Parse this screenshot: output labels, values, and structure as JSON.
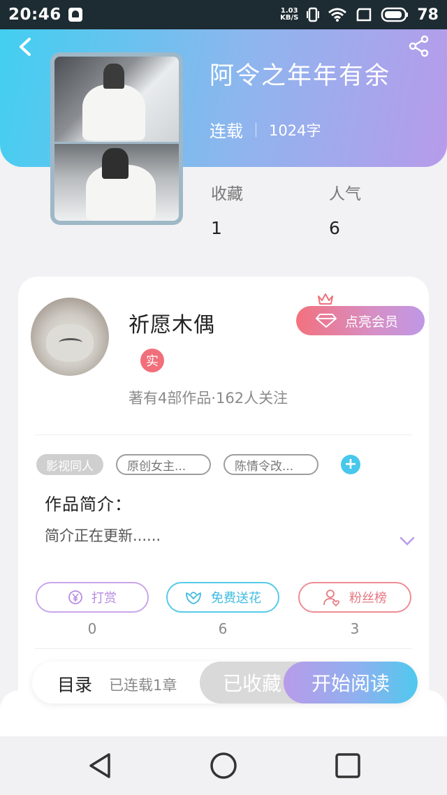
{
  "status_bar": {
    "time": "20:46",
    "net_speed_value": "1.03",
    "net_speed_unit": "KB/S",
    "battery": "78"
  },
  "book": {
    "title": "阿令之年年有余",
    "status": "连载",
    "word_count": "1024字",
    "stats": [
      {
        "label": "收藏",
        "value": "1"
      },
      {
        "label": "人气",
        "value": "6"
      }
    ]
  },
  "author": {
    "name": "祈愿木偶",
    "badge": "实",
    "meta": "著有4部作品·162人关注",
    "vip_label": "点亮会员"
  },
  "tags": [
    "影视同人",
    "原创女主...",
    "陈情令改..."
  ],
  "intro": {
    "title": "作品简介：",
    "text": "简介正在更新......"
  },
  "actions": [
    {
      "label": "打赏",
      "count": "0",
      "icon": "yen-icon"
    },
    {
      "label": "免费送花",
      "count": "6",
      "icon": "flower-icon"
    },
    {
      "label": "粉丝榜",
      "count": "3",
      "icon": "user-heart-icon"
    }
  ],
  "bottom_bar": {
    "toc_label": "目录",
    "chapters": "已连载1章",
    "collected_label": "已收藏",
    "read_label": "开始阅读"
  },
  "colors": {
    "header_start": "#42cff0",
    "header_end": "#b79bea",
    "badge_red": "#f06f7a",
    "accent_cyan": "#47c7ec"
  }
}
